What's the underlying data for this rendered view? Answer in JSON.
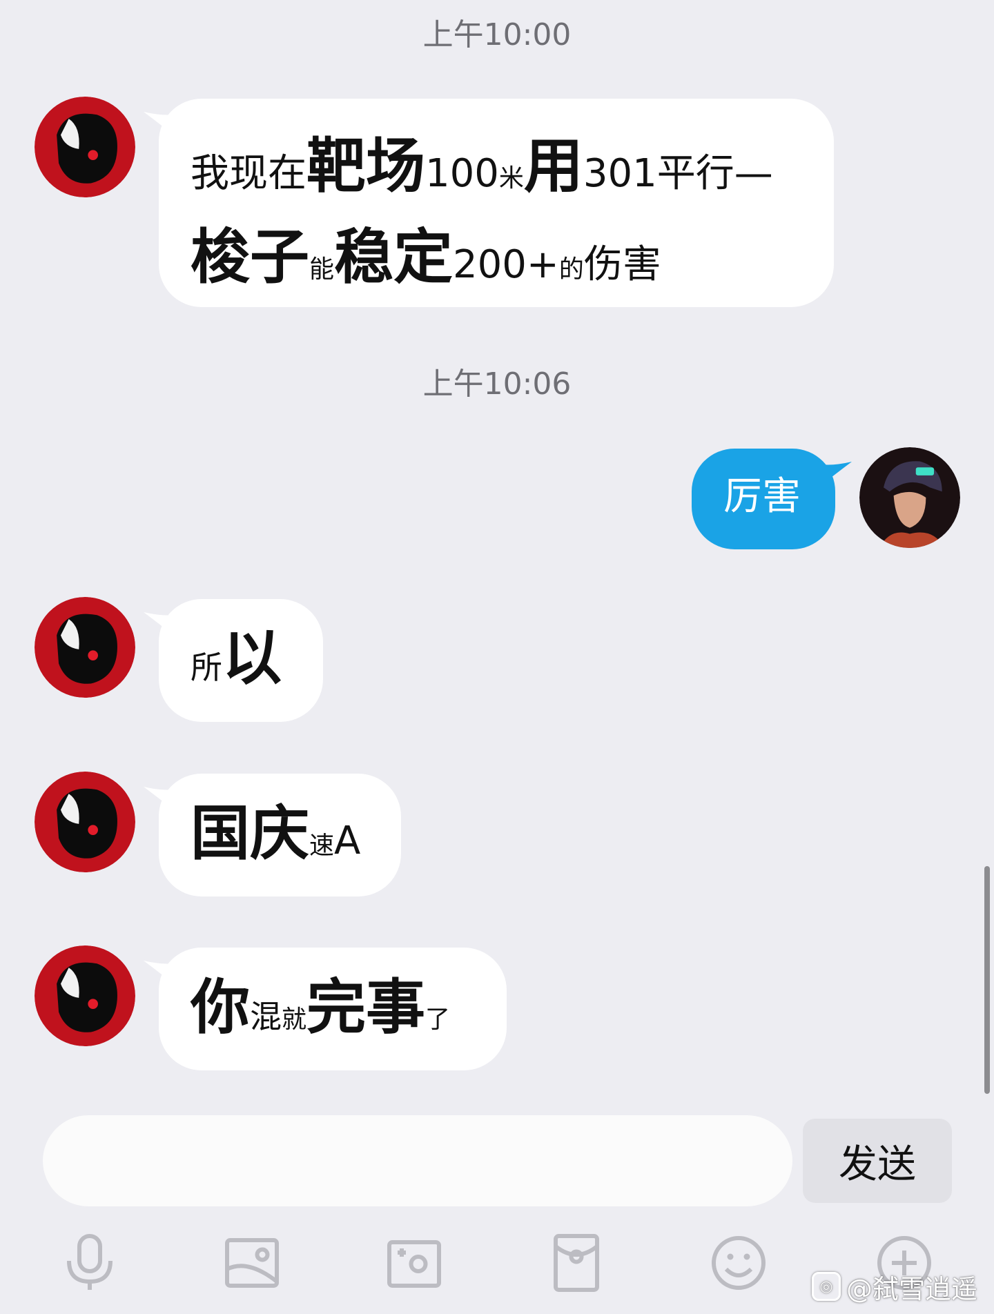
{
  "timestamps": [
    "上午10:00",
    "上午10:06"
  ],
  "messages": [
    {
      "sender": "other",
      "lines": [
        [
          {
            "t": "我现在",
            "s": "m"
          },
          {
            "t": "靶场",
            "s": "l"
          },
          {
            "t": "100",
            "s": "m"
          },
          {
            "t": "米",
            "s": "xs"
          },
          {
            "t": "用",
            "s": "l"
          },
          {
            "t": "301平行—",
            "s": "m"
          }
        ],
        [
          {
            "t": "梭子",
            "s": "l"
          },
          {
            "t": "能",
            "s": "xs"
          },
          {
            "t": "稳定",
            "s": "l"
          },
          {
            "t": "200+",
            "s": "m"
          },
          {
            "t": "的",
            "s": "xs"
          },
          {
            "t": "伤害",
            "s": "m"
          }
        ]
      ]
    },
    {
      "sender": "me",
      "lines": [
        [
          {
            "t": "厉害",
            "s": "m"
          }
        ]
      ]
    },
    {
      "sender": "other",
      "lines": [
        [
          {
            "t": "所",
            "s": "s"
          },
          {
            "t": "以",
            "s": "l"
          }
        ]
      ]
    },
    {
      "sender": "other",
      "lines": [
        [
          {
            "t": "国庆",
            "s": "l"
          },
          {
            "t": "速",
            "s": "xs"
          },
          {
            "t": "A",
            "s": "m"
          }
        ]
      ]
    },
    {
      "sender": "other",
      "lines": [
        [
          {
            "t": "你",
            "s": "l"
          },
          {
            "t": "混",
            "s": "s"
          },
          {
            "t": "就",
            "s": "xs"
          },
          {
            "t": "完事",
            "s": "l"
          },
          {
            "t": "了",
            "s": "xs"
          }
        ]
      ]
    }
  ],
  "composer": {
    "placeholder": "",
    "send_label": "发送"
  },
  "toolbar": [
    "mic-icon",
    "image-icon",
    "camera-icon",
    "red-packet-icon",
    "emoji-icon",
    "plus-icon"
  ],
  "watermark": {
    "text": "@弑雪逍遥"
  },
  "colors": {
    "background": "#ededf2",
    "my_bubble": "#1aa3e6",
    "other_bubble": "#ffffff",
    "avatar_red": "#c0121d"
  }
}
